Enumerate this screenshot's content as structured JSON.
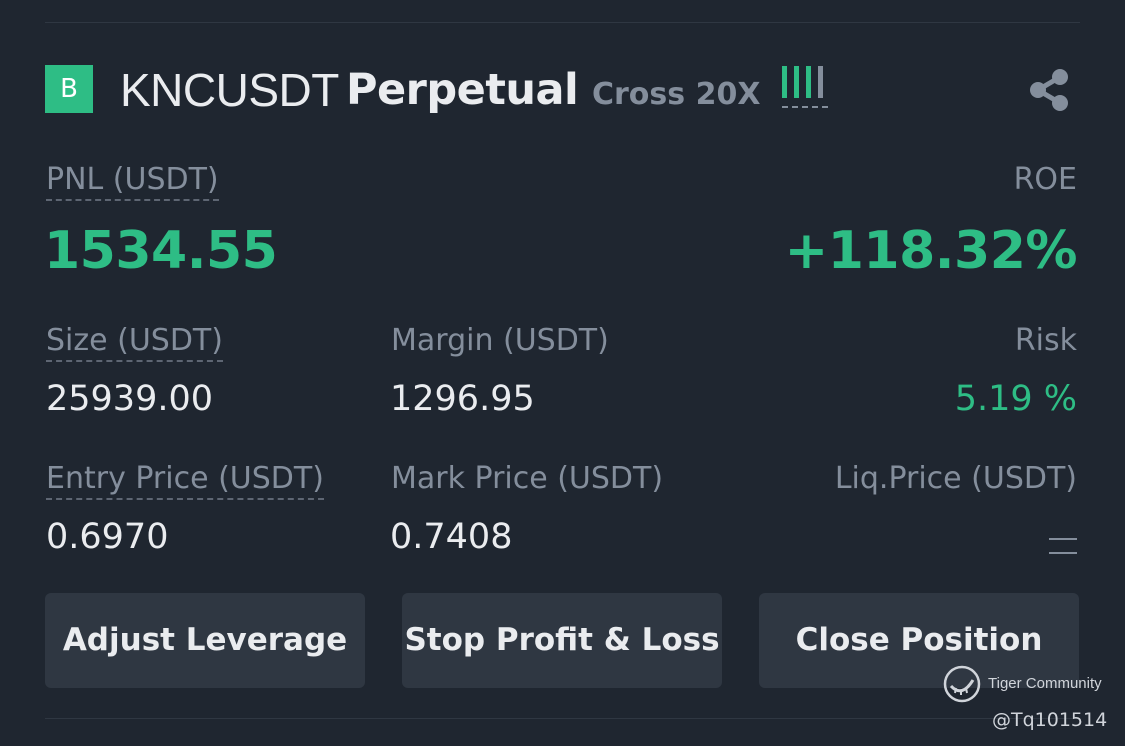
{
  "position": {
    "side_badge": "B",
    "symbol": "KNCUSDT",
    "contract_type": "Perpetual",
    "margin_mode": "Cross 20X",
    "leverage_indicator_icon": "leverage-bars-icon",
    "share_icon": "share-icon"
  },
  "pnl": {
    "label": "PNL (USDT)",
    "value": "1534.55"
  },
  "roe": {
    "label": "ROE",
    "value": "+118.32%"
  },
  "size": {
    "label": "Size (USDT)",
    "value": "25939.00"
  },
  "margin": {
    "label": "Margin (USDT)",
    "value": "1296.95"
  },
  "risk": {
    "label": "Risk",
    "value": "5.19 %"
  },
  "entry_price": {
    "label": "Entry Price (USDT)",
    "value": "0.6970"
  },
  "mark_price": {
    "label": "Mark Price (USDT)",
    "value": "0.7408"
  },
  "liq_price": {
    "label": "Liq.Price (USDT)",
    "value": "--"
  },
  "buttons": {
    "adjust_leverage": "Adjust Leverage",
    "stop_profit_loss": "Stop Profit & Loss",
    "close_position": "Close Position"
  },
  "watermark": {
    "name": "Tiger Community",
    "handle": "@Tq101514"
  },
  "colors": {
    "background": "#1f2630",
    "accent_green": "#2ebd85",
    "muted_text": "#848e9c",
    "primary_text": "#eaecef",
    "button_bg": "#2f3742"
  }
}
